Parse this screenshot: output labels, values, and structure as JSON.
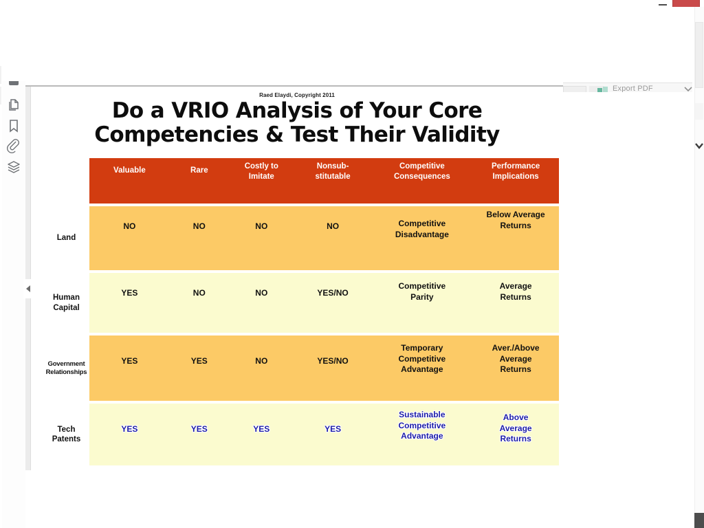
{
  "window": {
    "minimize_label": "–",
    "close_label": "×"
  },
  "toolrail": {
    "icons": [
      {
        "name": "partial-tool-icon",
        "label": ""
      },
      {
        "name": "page-thumbnails-icon",
        "label": "Page Thumbnails"
      },
      {
        "name": "bookmarks-icon",
        "label": "Bookmarks"
      },
      {
        "name": "attachments-icon",
        "label": "Attachments"
      },
      {
        "name": "layers-icon",
        "label": "Layers"
      }
    ]
  },
  "toolbar": {
    "export_label": "Export PDF",
    "chevron": "chevron-down"
  },
  "document": {
    "copyright": "Raed Elaydi, Copyright  2011",
    "title_line1": "Do a VRIO Analysis of Your Core",
    "title_line2": "Competencies & Test Their Validity"
  },
  "colors": {
    "header_bg": "#d23c10",
    "row_orange": "#fcca66",
    "row_yellow": "#fbfbcf",
    "highlight_text": "#1c1ca8",
    "close_button": "#c94a4a"
  },
  "table": {
    "columns": [
      "Valuable",
      "Rare",
      "Costly to\nImitate",
      "Nonsub-\nstitutable",
      "Competitive\nConsequences",
      "Performance\nImplications"
    ],
    "col_valuable": "Valuable",
    "col_rare": "Rare",
    "col_costly_1": "Costly to",
    "col_costly_2": "Imitate",
    "col_nonsub_1": "Nonsub-",
    "col_nonsub_2": "stitutable",
    "col_conseq_1": "Competitive",
    "col_conseq_2": "Consequences",
    "col_perf_1": "Performance",
    "col_perf_2": "Implications",
    "rows": [
      {
        "label_1": "Land",
        "label_2": "",
        "fill": "orange",
        "valuable": "NO",
        "rare": "NO",
        "costly": "NO",
        "nonsub": "NO",
        "consequence_1": "Competitive",
        "consequence_2": "Disadvantage",
        "performance_1": "Below Average",
        "performance_2": "Returns",
        "performance_3": "",
        "highlight": false
      },
      {
        "label_1": "Human",
        "label_2": "Capital",
        "fill": "yellow",
        "valuable": "YES",
        "rare": "NO",
        "costly": "NO",
        "nonsub": "YES/NO",
        "consequence_1": "Competitive",
        "consequence_2": "Parity",
        "performance_1": "Average",
        "performance_2": "Returns",
        "performance_3": "",
        "highlight": false
      },
      {
        "label_1": "Government",
        "label_2": "Relationships",
        "fill": "orange",
        "valuable": "YES",
        "rare": "YES",
        "costly": "NO",
        "nonsub": "YES/NO",
        "consequence_1": "Temporary",
        "consequence_2": "Competitive",
        "consequence_3": "Advantage",
        "performance_1": "Aver./Above",
        "performance_2": "Average",
        "performance_3": "Returns",
        "highlight": false
      },
      {
        "label_1": "Tech",
        "label_2": "Patents",
        "fill": "yellow",
        "valuable": "YES",
        "rare": "YES",
        "costly": "YES",
        "nonsub": "YES",
        "consequence_1": "Sustainable",
        "consequence_2": "Competitive",
        "consequence_3": "Advantage",
        "performance_1": "Above",
        "performance_2": "Average",
        "performance_3": "Returns",
        "highlight": true
      }
    ]
  }
}
